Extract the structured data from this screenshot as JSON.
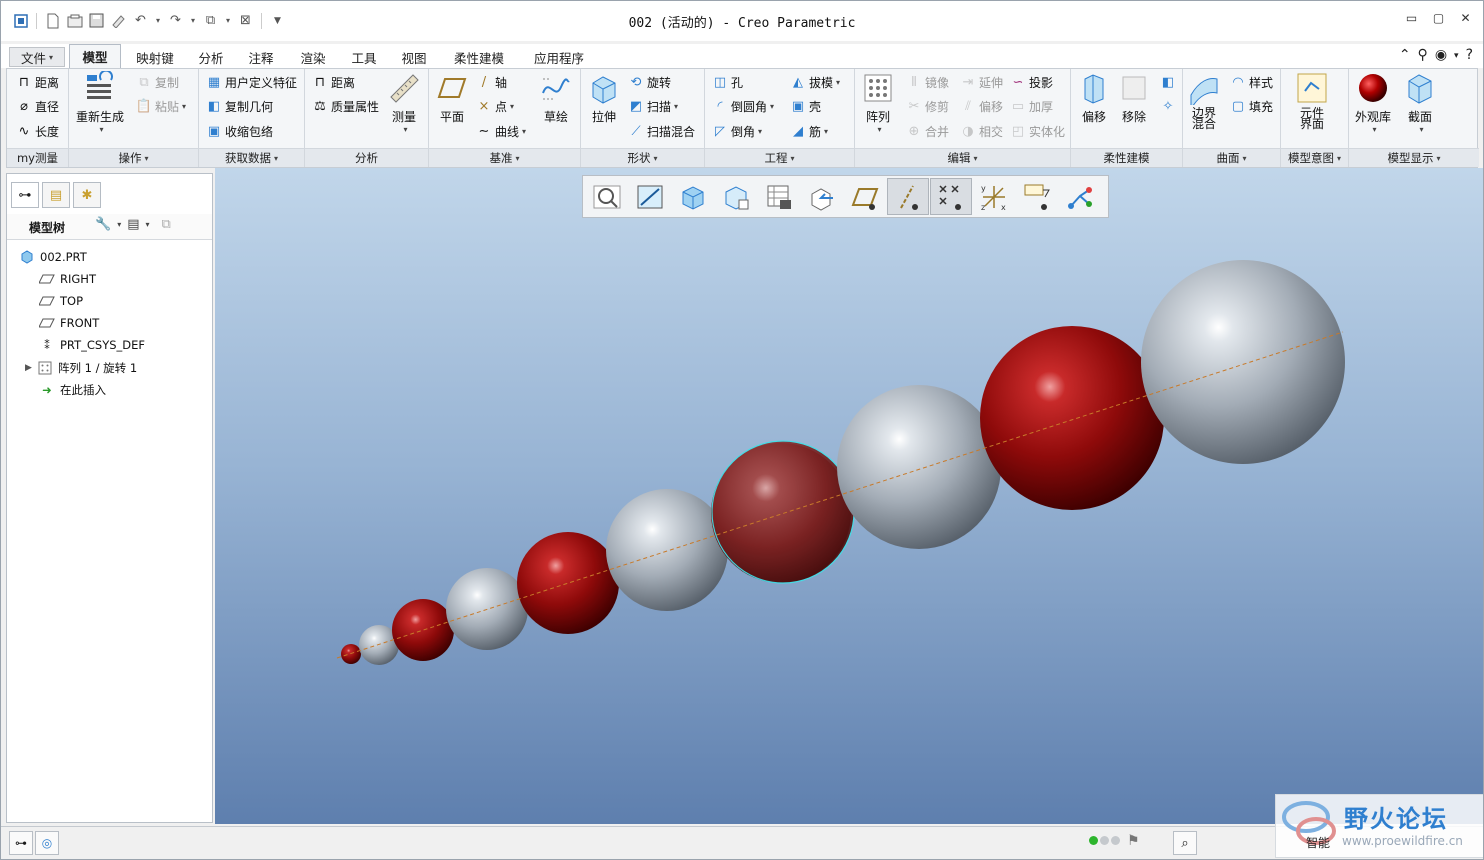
{
  "window": {
    "title": "002 (活动的) - Creo Parametric"
  },
  "tabs": [
    {
      "label": "文件"
    },
    {
      "label": "模型"
    },
    {
      "label": "映射键"
    },
    {
      "label": "分析"
    },
    {
      "label": "注释"
    },
    {
      "label": "渲染"
    },
    {
      "label": "工具"
    },
    {
      "label": "视图"
    },
    {
      "label": "柔性建模"
    },
    {
      "label": "应用程序"
    }
  ],
  "ribbon": {
    "groups": [
      {
        "label": "my测量"
      },
      {
        "label": "操作"
      },
      {
        "label": "获取数据"
      },
      {
        "label": "分析"
      },
      {
        "label": "基准"
      },
      {
        "label": "形状"
      },
      {
        "label": "工程"
      },
      {
        "label": "编辑"
      },
      {
        "label": "柔性建模"
      },
      {
        "label": "曲面"
      },
      {
        "label": "模型意图"
      },
      {
        "label": "模型显示"
      }
    ],
    "measure": [
      "距离",
      "直径",
      "长度"
    ],
    "ops": {
      "regen": "重新生成",
      "copy": "复制",
      "paste": "粘贴"
    },
    "getdata": [
      "用户定义特征",
      "复制几何",
      "收缩包络"
    ],
    "analysis": {
      "distance": "距离",
      "mass": "质量属性",
      "measure": "测量"
    },
    "datum": {
      "plane": "平面",
      "axis": "轴",
      "point": "点",
      "curve": "曲线",
      "sketch": "草绘"
    },
    "shape": {
      "extrude": "拉伸",
      "revolve": "旋转",
      "sweep": "扫描",
      "swept_blend": "扫描混合"
    },
    "eng": {
      "hole": "孔",
      "round": "倒圆角",
      "chamfer": "倒角",
      "draft": "拔模",
      "shell": "壳",
      "rib": "筋"
    },
    "edit": {
      "pattern": "阵列",
      "mirror": "镜像",
      "trim": "修剪",
      "merge": "合并",
      "extend": "延伸",
      "offset": "偏移",
      "intersect": "相交",
      "project": "投影",
      "thicken": "加厚",
      "solidify": "实体化"
    },
    "flex": {
      "move": "偏移",
      "remove": "移除"
    },
    "surface": {
      "boundary": "边界\n混合",
      "style": "样式",
      "fill": "填充"
    },
    "intent": {
      "component_interface": "元件\n界面"
    },
    "display": {
      "appearance": "外观库",
      "section": "截面"
    }
  },
  "tree": {
    "header": "模型树",
    "nodes": [
      {
        "label": "002.PRT",
        "icon": "part-icon"
      },
      {
        "label": "RIGHT",
        "icon": "datum-plane-icon"
      },
      {
        "label": "TOP",
        "icon": "datum-plane-icon"
      },
      {
        "label": "FRONT",
        "icon": "datum-plane-icon"
      },
      {
        "label": "PRT_CSYS_DEF",
        "icon": "csys-icon"
      },
      {
        "label": "阵列 1 / 旋转 1",
        "icon": "pattern-icon"
      },
      {
        "label": "在此插入",
        "icon": "insert-arrow-icon"
      }
    ]
  },
  "status": {
    "mode": "智能"
  },
  "watermark": {
    "title": "野火论坛",
    "url": "www.proewildfire.cn"
  },
  "colors": {
    "red_sphere": "#8e0a0a",
    "gray_sphere": "#a3acb6",
    "accent": "#2f7fcf",
    "viewport_top": "#c1d6ea",
    "viewport_bottom": "#5e7fae"
  }
}
